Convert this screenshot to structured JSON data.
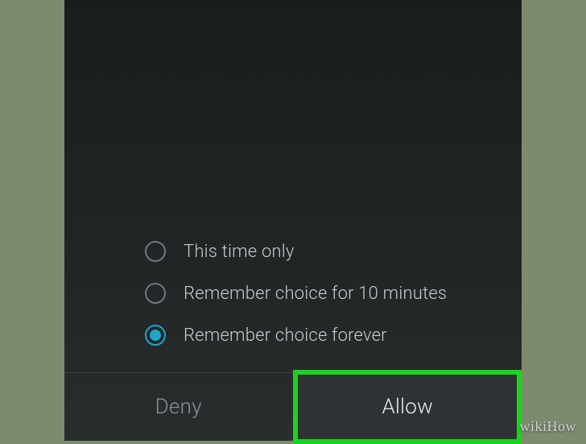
{
  "options": [
    {
      "label": "This time only",
      "selected": false
    },
    {
      "label": "Remember choice for 10 minutes",
      "selected": false
    },
    {
      "label": "Remember choice forever",
      "selected": true
    }
  ],
  "buttons": {
    "deny": "Deny",
    "allow": "Allow"
  },
  "watermark": "wikiHow",
  "highlight_color": "#18d41c",
  "accent_color": "#1ea6c9"
}
